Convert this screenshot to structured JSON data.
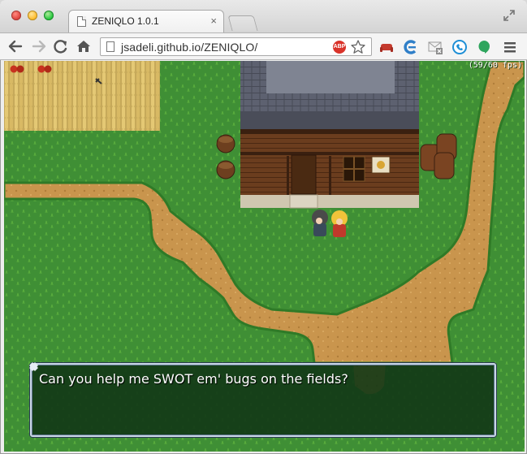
{
  "browser": {
    "tab": {
      "title": "ZENIQLO 1.0.1",
      "close_glyph": "×"
    },
    "address_bar": {
      "url": "jsadeli.github.io/ZENIQLO/"
    },
    "extensions": [
      "adblock-plus-icon",
      "bookmark-star-icon",
      "pocket-sofa-icon",
      "eclipse-icon",
      "gmail-checker-icon",
      "skype-icon",
      "hangouts-icon",
      "chrome-menu-icon"
    ],
    "abp_label": "ABP"
  },
  "game": {
    "fps_counter": "(59/60 fps)",
    "dialog": {
      "text": "Can you help me SWOT em' bugs on the fields?"
    },
    "colors": {
      "grass": "#3f8f35",
      "dirt": "#c9954d",
      "roof": "#5b5f6e",
      "wall": "#6b3d1e",
      "dialog_bg": "#14391a",
      "dialog_border": "#c8d6e4"
    }
  }
}
